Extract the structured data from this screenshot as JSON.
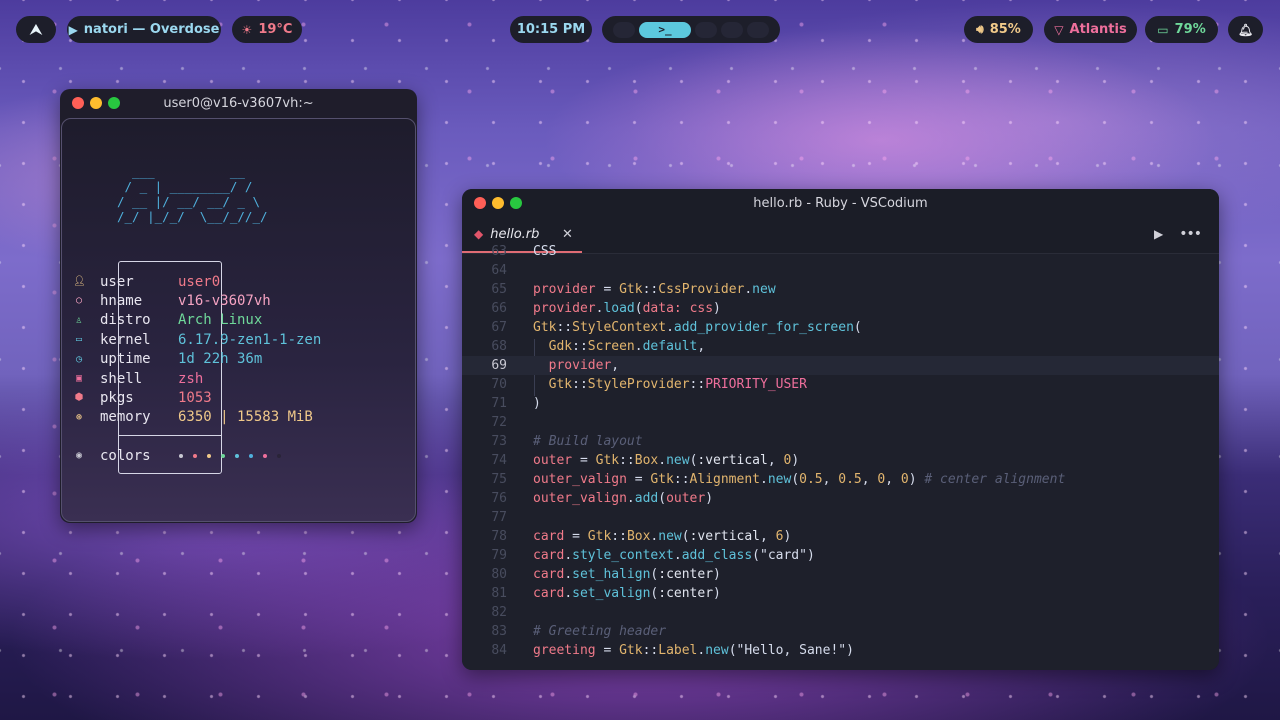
{
  "topbar": {
    "left": [
      {
        "icon": "arch-logo-icon",
        "label": ""
      },
      {
        "icon": "play-icon",
        "label": "natori — Overdose"
      },
      {
        "icon": "sun-icon",
        "label": "19°C"
      }
    ],
    "clock": "10:15 PM",
    "workspace_active_glyph": ">_",
    "right": [
      {
        "icon": "speaker-icon",
        "label": "85%"
      },
      {
        "icon": "wifi-icon",
        "label": "Atlantis"
      },
      {
        "icon": "battery-icon",
        "label": "79%"
      },
      {
        "icon": "bell-icon",
        "label": ""
      }
    ]
  },
  "terminal": {
    "title": "user0@v16-v3607vh:~",
    "ascii_art": "  ___          __\n / _ | ________/ /\n/ __ |/ __/ __/ _ \\\n/_/ |_/_/  \\__/_//_/",
    "fields": [
      {
        "icon": "user-icon",
        "label": "user",
        "value": "user0",
        "color": "#f07a8a"
      },
      {
        "icon": "circle-icon",
        "label": "hname",
        "value": "v16-v3607vh",
        "color": "#f5a3c2"
      },
      {
        "icon": "distro-icon",
        "label": "distro",
        "value": "Arch Linux",
        "color": "#6fd89a"
      },
      {
        "icon": "laptop-icon",
        "label": "kernel",
        "value": "6.17.9-zen1-1-zen",
        "color": "#5fc2da"
      },
      {
        "icon": "clock-icon",
        "label": "uptime",
        "value": "1d 22h 36m",
        "color": "#5fc2da"
      },
      {
        "icon": "terminal-icon",
        "label": "shell",
        "value": "zsh",
        "color": "#ee6f9c"
      },
      {
        "icon": "package-icon",
        "label": "pkgs",
        "value": "1053",
        "color": "#f07a8a"
      },
      {
        "icon": "memory-icon",
        "label": "memory",
        "value": "6350 | 15583 MiB",
        "color": "#f0c98a"
      }
    ],
    "colors_label": "colors",
    "palette": [
      "#c8c8d2",
      "#f07a8a",
      "#f0c98a",
      "#6fd89a",
      "#5fc2da",
      "#4fb0dc",
      "#ee6f9c",
      "#2a2438"
    ]
  },
  "editor": {
    "window_title": "hello.rb - Ruby - VSCodium",
    "tab_name": "hello.rb",
    "current_line": 69,
    "lines": [
      {
        "n": "63",
        "html": "<span class=\"s\">CSS</span>"
      },
      {
        "n": "64",
        "html": ""
      },
      {
        "n": "65",
        "html": "<span class=\"k\">provider</span> <span class=\"s\">=</span> <span class=\"c\">Gtk</span><span class=\"s\">::</span><span class=\"c\">CssProvider</span><span class=\"s\">.</span><span class=\"m\">new</span>"
      },
      {
        "n": "66",
        "html": "<span class=\"k\">provider</span><span class=\"s\">.</span><span class=\"m\">load</span><span class=\"s\">(</span><span class=\"k\">data:</span> <span class=\"k\">css</span><span class=\"s\">)</span>"
      },
      {
        "n": "67",
        "html": "<span class=\"c\">Gtk</span><span class=\"s\">::</span><span class=\"c\">StyleContext</span><span class=\"s\">.</span><span class=\"m\">add_provider_for_screen</span><span class=\"s\">(</span>"
      },
      {
        "n": "68",
        "html": "  <span class=\"c\">Gdk</span><span class=\"s\">::</span><span class=\"c\">Screen</span><span class=\"s\">.</span><span class=\"m\">default</span><span class=\"s\">,</span>"
      },
      {
        "n": "69",
        "html": "  <span class=\"k\">provider</span><span class=\"s\">,</span>"
      },
      {
        "n": "70",
        "html": "  <span class=\"c\">Gtk</span><span class=\"s\">::</span><span class=\"c\">StyleProvider</span><span class=\"s\">::</span><span class=\"pr\">PRIORITY_USER</span>"
      },
      {
        "n": "71",
        "html": "<span class=\"s\">)</span>"
      },
      {
        "n": "72",
        "html": ""
      },
      {
        "n": "73",
        "html": "<span class=\"cm\"># Build layout</span>"
      },
      {
        "n": "74",
        "html": "<span class=\"k\">outer</span> <span class=\"s\">=</span> <span class=\"c\">Gtk</span><span class=\"s\">::</span><span class=\"c\">Box</span><span class=\"s\">.</span><span class=\"m\">new</span><span class=\"s\">(</span><span class=\"sym\">:vertical</span><span class=\"s\">,</span> <span class=\"n\">0</span><span class=\"s\">)</span>"
      },
      {
        "n": "75",
        "html": "<span class=\"k\">outer_valign</span> <span class=\"s\">=</span> <span class=\"c\">Gtk</span><span class=\"s\">::</span><span class=\"c\">Alignment</span><span class=\"s\">.</span><span class=\"m\">new</span><span class=\"s\">(</span><span class=\"n\">0.5</span><span class=\"s\">,</span> <span class=\"n\">0.5</span><span class=\"s\">,</span> <span class=\"n\">0</span><span class=\"s\">,</span> <span class=\"n\">0</span><span class=\"s\">)</span> <span class=\"cm\"># center alignment</span>"
      },
      {
        "n": "76",
        "html": "<span class=\"k\">outer_valign</span><span class=\"s\">.</span><span class=\"m\">add</span><span class=\"s\">(</span><span class=\"k\">outer</span><span class=\"s\">)</span>"
      },
      {
        "n": "77",
        "html": ""
      },
      {
        "n": "78",
        "html": "<span class=\"k\">card</span> <span class=\"s\">=</span> <span class=\"c\">Gtk</span><span class=\"s\">::</span><span class=\"c\">Box</span><span class=\"s\">.</span><span class=\"m\">new</span><span class=\"s\">(</span><span class=\"sym\">:vertical</span><span class=\"s\">,</span> <span class=\"n\">6</span><span class=\"s\">)</span>"
      },
      {
        "n": "79",
        "html": "<span class=\"k\">card</span><span class=\"s\">.</span><span class=\"m\">style_context</span><span class=\"s\">.</span><span class=\"m\">add_class</span><span class=\"s\">(\"card\")</span>"
      },
      {
        "n": "80",
        "html": "<span class=\"k\">card</span><span class=\"s\">.</span><span class=\"m\">set_halign</span><span class=\"s\">(</span><span class=\"sym\">:center</span><span class=\"s\">)</span>"
      },
      {
        "n": "81",
        "html": "<span class=\"k\">card</span><span class=\"s\">.</span><span class=\"m\">set_valign</span><span class=\"s\">(</span><span class=\"sym\">:center</span><span class=\"s\">)</span>"
      },
      {
        "n": "82",
        "html": ""
      },
      {
        "n": "83",
        "html": "<span class=\"cm\"># Greeting header</span>"
      },
      {
        "n": "84",
        "html": "<span class=\"k\">greeting</span> <span class=\"s\">=</span> <span class=\"c\">Gtk</span><span class=\"s\">::</span><span class=\"c\">Label</span><span class=\"s\">.</span><span class=\"m\">new</span><span class=\"s\">(\"Hello, Sane!\")</span>"
      }
    ]
  },
  "colors": {
    "accent": "#5cc8de",
    "bar_bg": "#1d1e2a",
    "close": "#ff5f57",
    "minimize": "#febc2e",
    "maximize": "#28c840"
  }
}
